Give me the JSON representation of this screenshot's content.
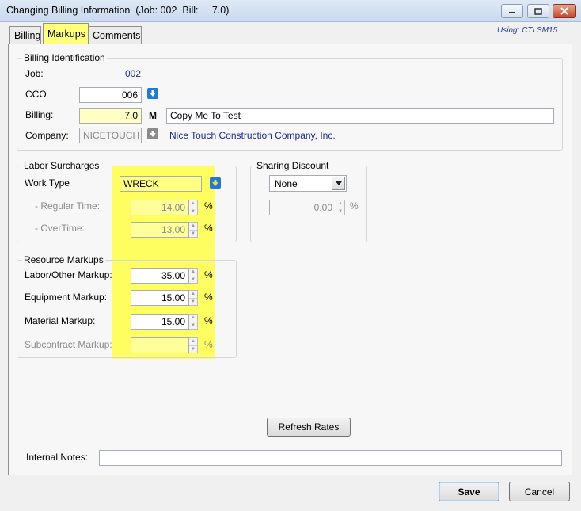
{
  "window": {
    "title": "Changing Billing Information  (Job: 002  Bill:     7.0)"
  },
  "tabs": [
    "Billing",
    "Markups",
    "Comments"
  ],
  "using": "Using:  CTLSM15",
  "billing_identification": {
    "legend": "Billing Identification",
    "job_label": "Job:",
    "job_value": "002",
    "cco_label": "CCO",
    "cco_value": "006",
    "billing_label": "Billing:",
    "billing_value": "7.0",
    "billing_flag": "M",
    "billing_description": "Copy Me To Test",
    "company_label": "Company:",
    "company_code": "NICETOUCH",
    "company_name": "Nice Touch Construction Company, Inc."
  },
  "labor_surcharges": {
    "legend": "Labor Surcharges",
    "work_type_label": "Work Type",
    "work_type_value": "WRECK",
    "regular_label": "- Regular Time:",
    "regular_value": "14.00",
    "overtime_label": "- OverTime:",
    "overtime_value": "13.00"
  },
  "sharing_discount": {
    "legend": "Sharing Discount",
    "select_value": "None",
    "percent_value": "0.00"
  },
  "resource_markups": {
    "legend": "Resource Markups",
    "labor_label": "Labor/Other Markup:",
    "labor_value": "35.00",
    "equipment_label": "Equipment Markup:",
    "equipment_value": "15.00",
    "material_label": "Material Markup:",
    "material_value": "15.00",
    "subcontract_label": "Subcontract Markup:",
    "subcontract_value": ""
  },
  "percent_symbol": "%",
  "refresh_button": "Refresh Rates",
  "internal_notes_label": "Internal Notes:",
  "internal_notes_value": "",
  "save_button": "Save",
  "cancel_button": "Cancel",
  "colors": {
    "highlight": "#ffff46",
    "accent_blue": "#1e2a8c",
    "lookup_icon_blue": "#1f7ad6"
  },
  "icons": [
    "minimize-icon",
    "maximize-icon",
    "close-icon",
    "lookup-arrow-icon",
    "dropdown-arrow-icon",
    "spinner-up-icon",
    "spinner-down-icon"
  ]
}
